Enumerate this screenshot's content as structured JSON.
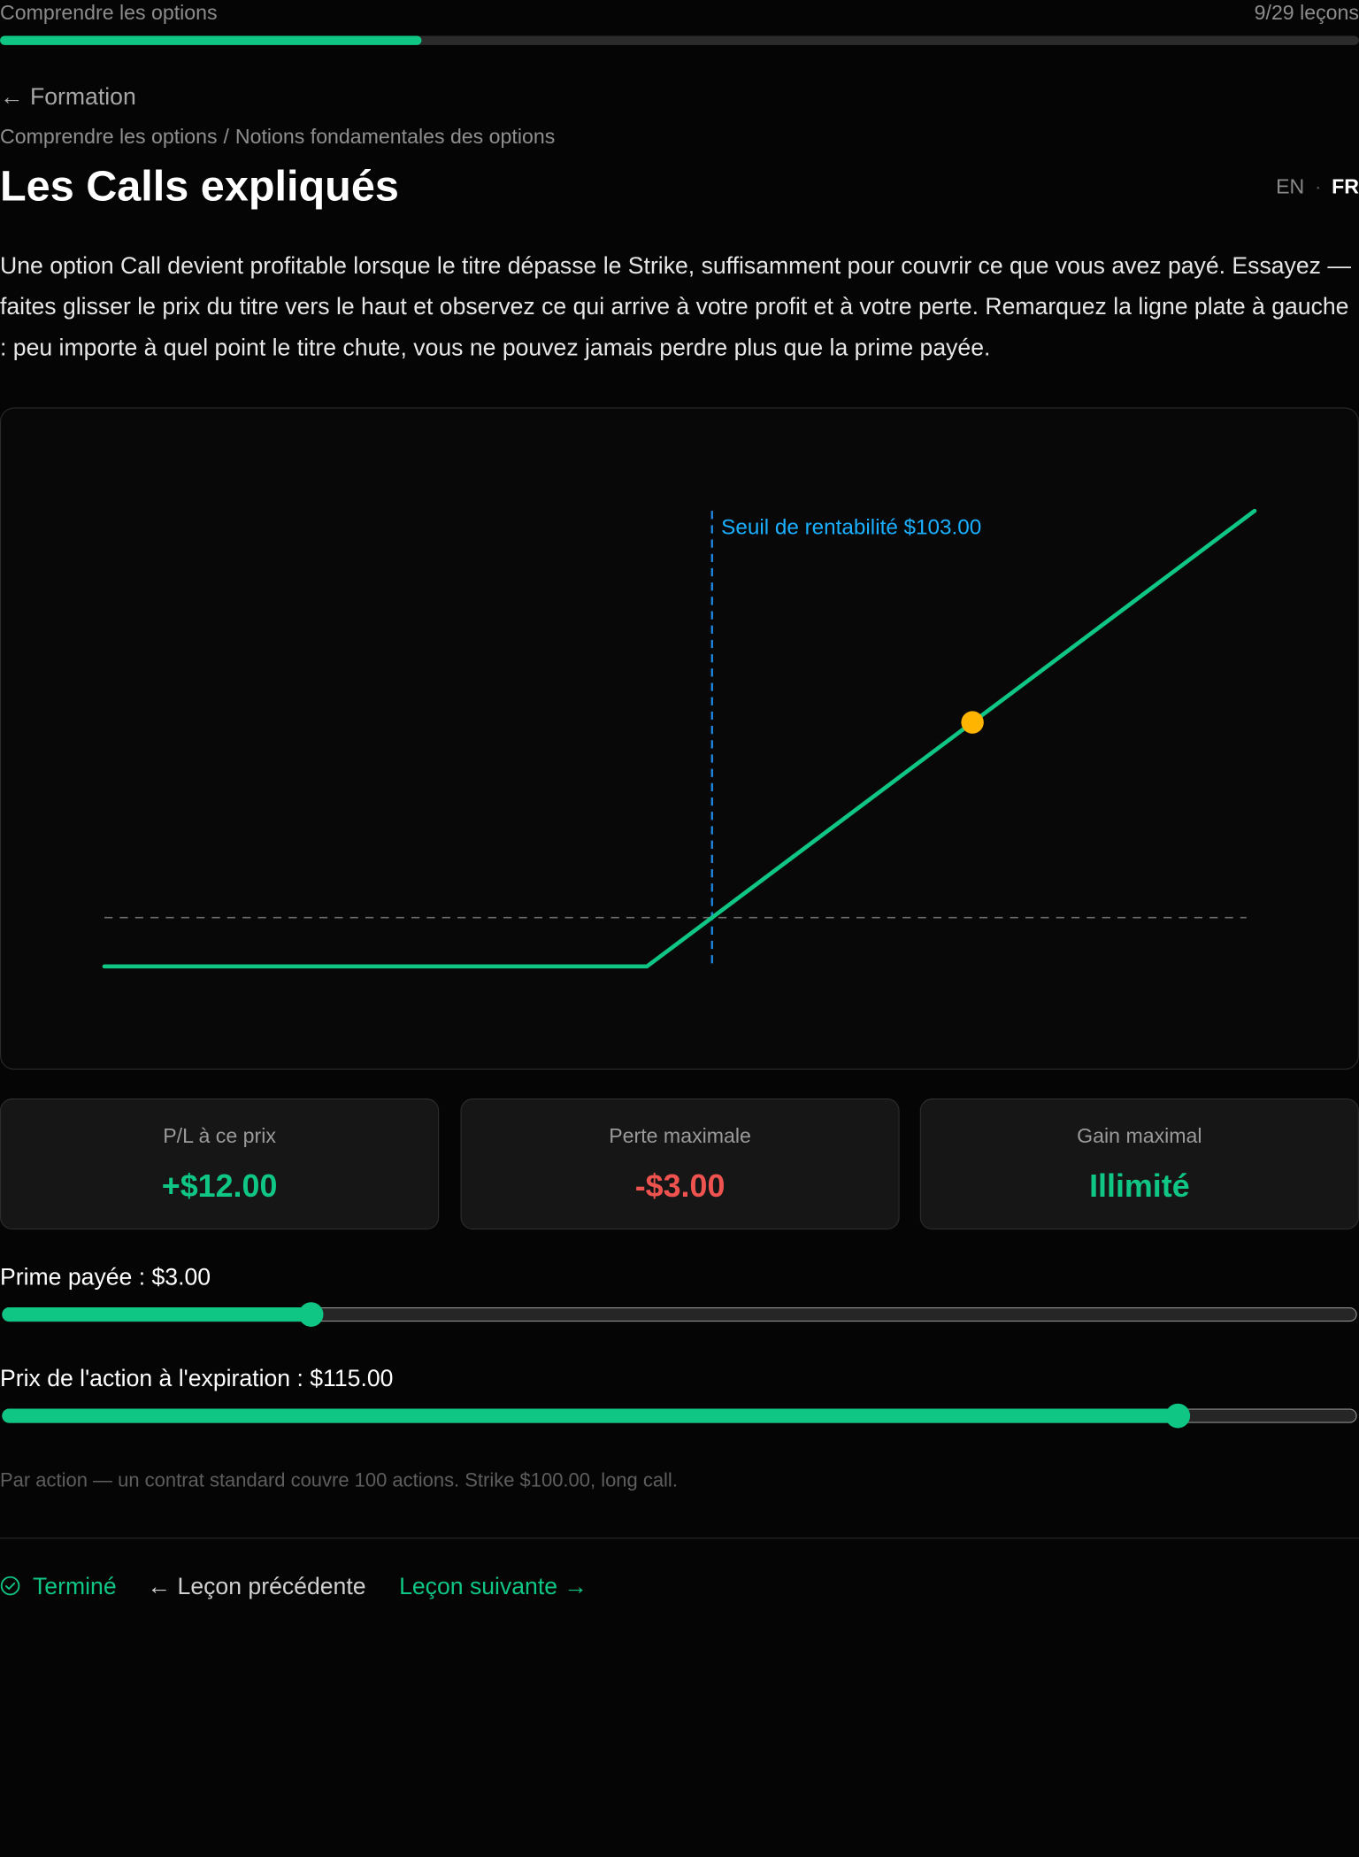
{
  "topbar": {
    "course_title": "Comprendre les options",
    "progress_text": "9/29 leçons",
    "progress_fraction": 0.31
  },
  "nav": {
    "back_label": "← Formation"
  },
  "breadcrumb": {
    "course": "Comprendre les options",
    "separator": "/",
    "module": "Notions fondamentales des options"
  },
  "lesson": {
    "title": "Les Calls expliqués",
    "intro": "Une option Call devient profitable lorsque le titre dépasse le Strike, suffisamment pour couvrir ce que vous avez payé. Essayez — faites glisser le prix du titre vers le haut et observez ce qui arrive à votre profit et à votre perte. Remarquez la ligne plate à gauche : peu importe à quel point le titre chute, vous ne pouvez jamais perdre plus que la prime payée."
  },
  "language": {
    "en_label": "EN",
    "separator": "·",
    "fr_label": "FR",
    "active": "FR"
  },
  "chart_data": {
    "type": "line",
    "x": [
      75,
      100,
      128
    ],
    "series": [
      {
        "values": [
          -3,
          -3,
          25
        ]
      }
    ],
    "xlim": [
      75,
      128
    ],
    "ylim": [
      -3,
      25
    ],
    "zero_line": 0,
    "breakeven": {
      "x": 103,
      "label": "Seuil de rentabilité $103.00"
    },
    "marker": {
      "x": 115,
      "y": 12
    },
    "colors": {
      "line": "#10c684",
      "breakeven": "#1e88e5",
      "breakeven_label": "#1ab0ff",
      "marker": "#ffb400",
      "zero_line": "#6b6b6b"
    }
  },
  "stats": [
    {
      "label": "P/L à ce prix",
      "value": "+$12.00",
      "color": "#10c684"
    },
    {
      "label": "Perte maximale",
      "value": "-$3.00",
      "color": "#ef5350"
    },
    {
      "label": "Gain maximal",
      "value": "Illimité",
      "color": "#10c684"
    }
  ],
  "sliders": {
    "premium": {
      "label": "Prime payée : $3.00",
      "fraction": 0.228
    },
    "price": {
      "label": "Prix de l'action à l'expiration : $115.00",
      "fraction": 0.868
    }
  },
  "footnote": "Par action — un contrat standard couvre 100 actions. Strike $100.00, long call.",
  "footer": {
    "done_label": "Terminé",
    "prev_label": "← Leçon précédente",
    "next_label": "Leçon suivante →"
  }
}
